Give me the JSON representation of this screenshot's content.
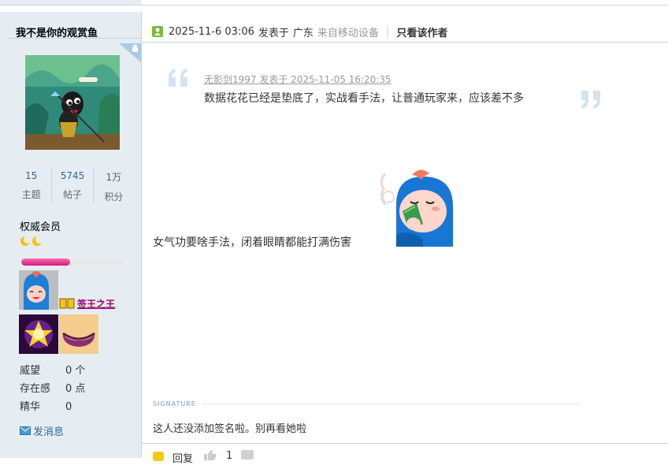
{
  "author": {
    "username": "我不是你的观赏鱼",
    "stats": [
      {
        "value": "15",
        "label": "主题"
      },
      {
        "value": "5745",
        "label": "帖子"
      },
      {
        "value": "1万",
        "label": "积分"
      }
    ],
    "group": "权威会员",
    "exp_progress": 0.48,
    "medal_name": "签王之王",
    "info": [
      {
        "key": "威望",
        "value": "0 个"
      },
      {
        "key": "存在感",
        "value": "0 点"
      },
      {
        "key": "精华",
        "value": "0"
      }
    ],
    "send_message": "发消息"
  },
  "post": {
    "time": "2025-11-6 03:06",
    "posted_in": "发表于",
    "location": "广东",
    "device": "来自移动设备",
    "only_author": "只看该作者",
    "quote": {
      "author_line": "无影剑1997 发表于 2025-11-05 16:20:35",
      "text": "数据花花已经是垫底了，实战看手法，让普通玩家来，应该差不多"
    },
    "body": "女气功要啥手法，闭着眼睛都能打满伤害",
    "signature_label": "SIGNATURE",
    "signature": "这人还没添加签名啦。别再看她啦"
  },
  "actions": {
    "reply": "回复",
    "likes": "1"
  },
  "colors": {
    "sidebar_bg": "#e5edf2",
    "border": "#c2d5e3",
    "link": "#336699",
    "exp": "#e0338e"
  }
}
